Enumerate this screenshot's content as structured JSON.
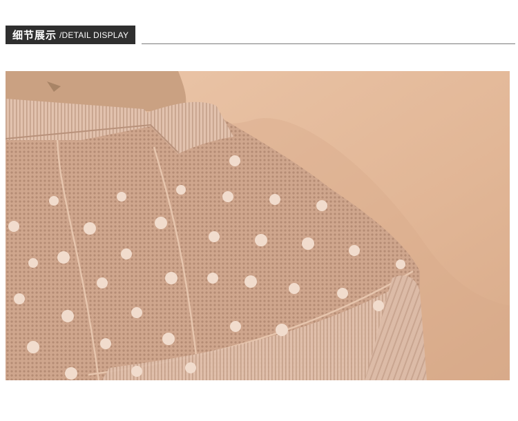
{
  "header": {
    "title_cn": "细节展示",
    "title_en": "/DETAIL DISPLAY"
  },
  "photo": {
    "subject": "close-up of blouse shoulder",
    "colors": {
      "background": "#e4bb9c",
      "fabric": "#d8ae95",
      "lace": "#caa28b",
      "dots": "#f1dccd"
    }
  }
}
